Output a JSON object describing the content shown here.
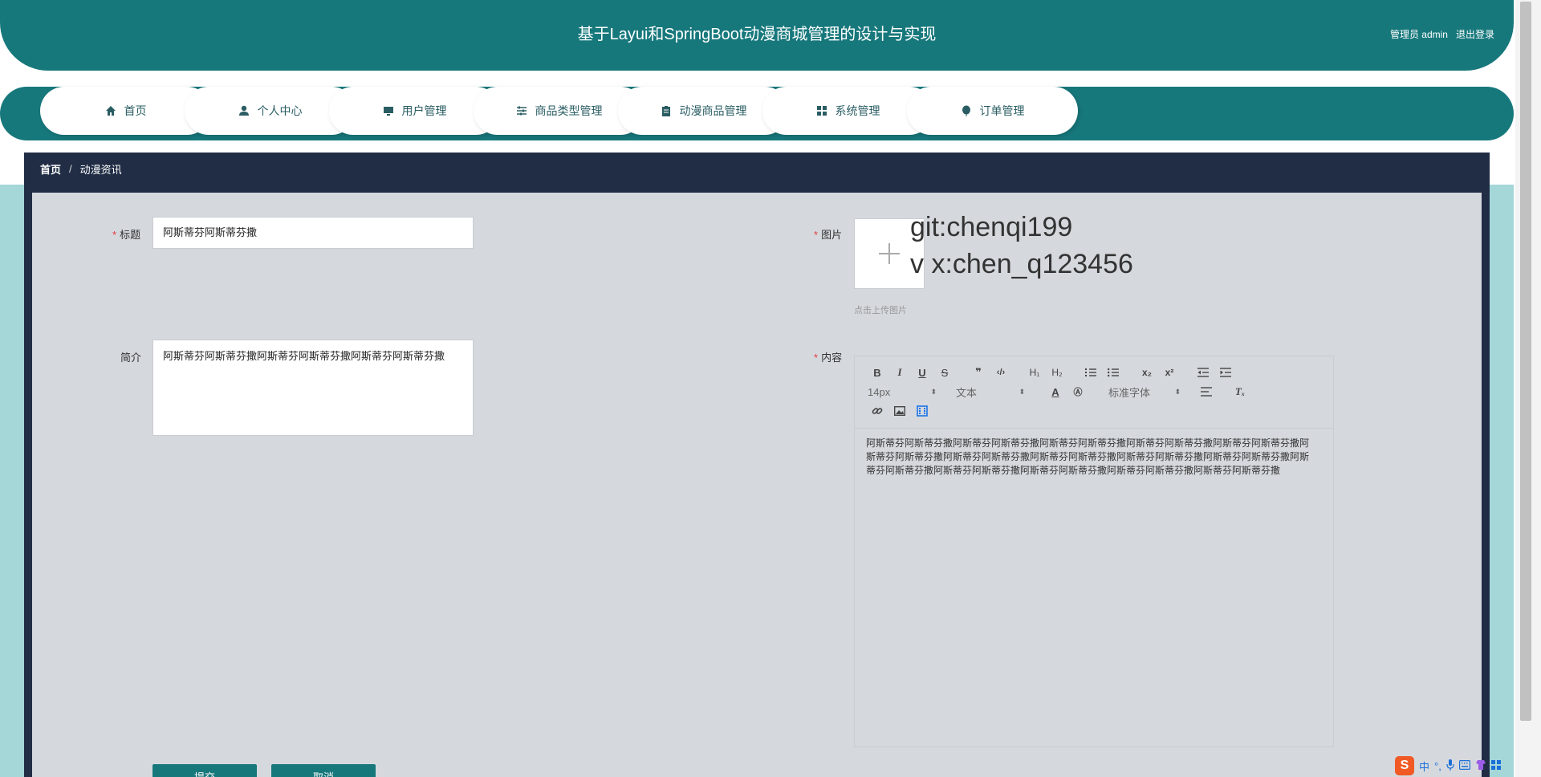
{
  "header": {
    "title": "基于Layui和SpringBoot动漫商城管理的设计与实现",
    "user_label": "管理员 admin",
    "logout_label": "退出登录"
  },
  "nav": {
    "items": [
      {
        "label": "首页",
        "icon": "home-icon"
      },
      {
        "label": "个人中心",
        "icon": "user-icon"
      },
      {
        "label": "用户管理",
        "icon": "monitor-icon"
      },
      {
        "label": "商品类型管理",
        "icon": "sliders-icon"
      },
      {
        "label": "动漫商品管理",
        "icon": "clipboard-icon"
      },
      {
        "label": "系统管理",
        "icon": "grid-icon"
      },
      {
        "label": "订单管理",
        "icon": "balloon-icon"
      }
    ]
  },
  "breadcrumb": {
    "home": "首页",
    "separator": "/",
    "current": "动漫资讯"
  },
  "form": {
    "title_label": "标题",
    "title_value": "阿斯蒂芬阿斯蒂芬撒",
    "summary_label": "简介",
    "summary_value": "阿斯蒂芬阿斯蒂芬撒阿斯蒂芬阿斯蒂芬撒阿斯蒂芬阿斯蒂芬撒",
    "image_label": "图片",
    "upload_hint": "点击上传图片",
    "watermark_line1": "git:chenqi199",
    "watermark_line2": "v x:chen_q123456",
    "content_label": "内容",
    "required_mark": "*"
  },
  "editor": {
    "font_size": "14px",
    "block_type": "文本",
    "font_family": "标准字体",
    "body": "阿斯蒂芬阿斯蒂芬撒阿斯蒂芬阿斯蒂芬撒阿斯蒂芬阿斯蒂芬撒阿斯蒂芬阿斯蒂芬撒阿斯蒂芬阿斯蒂芬撒阿斯蒂芬阿斯蒂芬撒阿斯蒂芬阿斯蒂芬撒阿斯蒂芬阿斯蒂芬撒阿斯蒂芬阿斯蒂芬撒阿斯蒂芬阿斯蒂芬撒阿斯蒂芬阿斯蒂芬撒阿斯蒂芬阿斯蒂芬撒阿斯蒂芬阿斯蒂芬撒阿斯蒂芬阿斯蒂芬撒阿斯蒂芬阿斯蒂芬撒"
  },
  "buttons": {
    "submit": "提交",
    "cancel": "取消"
  },
  "ime": {
    "logo": "S",
    "lang": "中"
  },
  "colors": {
    "primary": "#17787c",
    "dark": "#202d45",
    "panel": "#d5d9de",
    "side": "#a5d6d8"
  }
}
